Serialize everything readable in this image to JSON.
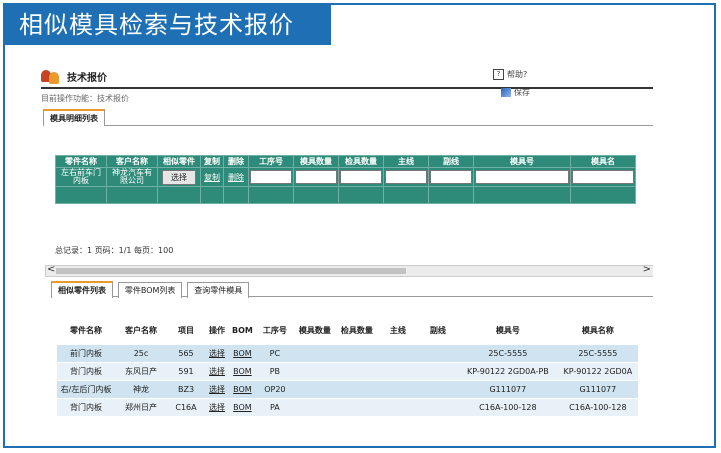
{
  "banner": "相似模具检索与技术报价",
  "app": {
    "title": "技术报价",
    "help": "帮助?",
    "save": "保存",
    "breadcrumb": "目前操作功能：技术报价"
  },
  "tabs1": [
    "模具明细列表"
  ],
  "table1": {
    "headers": [
      "零件名称",
      "客户名称",
      "相似零件",
      "复制",
      "删除",
      "工序号",
      "模具数量",
      "检具数量",
      "主线",
      "副线",
      "模具号",
      "模具名"
    ],
    "row": {
      "part": "左右前车门内板",
      "customer": "神龙汽车有限公司",
      "select": "选择",
      "copy": "复制",
      "delete": "删除"
    }
  },
  "total": "总记录：1 页码：1/1 每页：100",
  "scroll": {
    "left": "<",
    "right": ">"
  },
  "tabs2": [
    "相似零件列表",
    "零件BOM列表",
    "查询零件模具"
  ],
  "table2": {
    "headers": [
      "零件名称",
      "客户名称",
      "项目",
      "操作",
      "BOM",
      "工序号",
      "模具数量",
      "检具数量",
      "主线",
      "副线",
      "模具号",
      "模具名称"
    ],
    "rows": [
      [
        "前门内板",
        "25c",
        "565",
        "选择",
        "BOM",
        "PC",
        "",
        "",
        "",
        "",
        "25C-5555",
        "25C-5555"
      ],
      [
        "背门内板",
        "东风日产",
        "591",
        "选择",
        "BOM",
        "PB",
        "",
        "",
        "",
        "",
        "KP-90122 2GD0A-PB",
        "KP-90122 2GD0A"
      ],
      [
        "右/左后门内板",
        "神龙",
        "BZ3",
        "选择",
        "BOM",
        "OP20",
        "",
        "",
        "",
        "",
        "G111077",
        "G111077"
      ],
      [
        "背门内板",
        "郑州日产",
        "C16A",
        "选择",
        "BOM",
        "PA",
        "",
        "",
        "",
        "",
        "C16A-100-128",
        "C16A-100-128"
      ]
    ]
  }
}
